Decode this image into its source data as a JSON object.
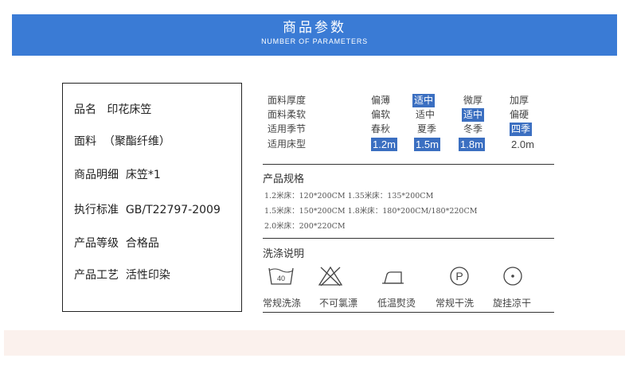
{
  "header": {
    "title": "商品参数",
    "subtitle": "NUMBER OF PARAMETERS",
    "bg_color": "#3a7bd5"
  },
  "product_info": [
    {
      "label": "品名",
      "value": "印花床笠"
    },
    {
      "label": "面料",
      "value": "（聚酯纤维）"
    },
    {
      "label": "商品明细",
      "value": "床笠*1"
    },
    {
      "label": "执行标准",
      "value": "GB/T22797-2009"
    },
    {
      "label": "产品等级",
      "value": "合格品"
    },
    {
      "label": "产品工艺",
      "value": "活性印染"
    }
  ],
  "parameters": [
    {
      "name": "面料厚度",
      "options": [
        "偏薄",
        "适中",
        "微厚",
        "加厚"
      ],
      "selected": "适中"
    },
    {
      "name": "面料柔软",
      "options": [
        "偏软",
        "适中",
        "适中",
        "偏硬"
      ],
      "selected_index": 2
    },
    {
      "name": "适用季节",
      "options": [
        "春秋",
        "夏季",
        "冬季",
        "四季"
      ],
      "selected": "四季"
    },
    {
      "name": "适用床型",
      "options": [
        "1.2m",
        "1.5m",
        "1.8m",
        "2.0m"
      ],
      "selected": [
        "1.2m",
        "1.5m",
        "1.8m"
      ]
    }
  ],
  "specs": {
    "title": "产品规格",
    "lines": [
      "1.2米床：120*200CM 1.35米床：135*200CM",
      "1.5米床：150*200CM 1.8米床：180*200CM/180*220CM",
      "2.0米床：200*220CM"
    ]
  },
  "wash": {
    "title": "洗涤说明",
    "items": [
      {
        "icon": "wash-40-icon",
        "label": "常规洗涤",
        "temp": "40"
      },
      {
        "icon": "no-bleach-icon",
        "label": "不可氯漂"
      },
      {
        "icon": "low-iron-icon",
        "label": "低温熨烫"
      },
      {
        "icon": "dry-clean-icon",
        "label": "常规干洗",
        "letter": "P"
      },
      {
        "icon": "line-dry-icon",
        "label": "旋挂凉干"
      }
    ]
  },
  "colors": {
    "selected_bg": "#3b6fc1",
    "footer_band": "#fbf1ed"
  }
}
